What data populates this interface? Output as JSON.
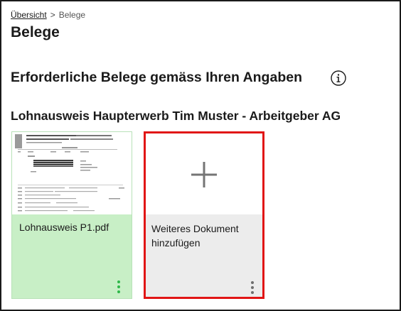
{
  "breadcrumb": {
    "parent": "Übersicht",
    "separator": ">",
    "current": "Belege"
  },
  "page_title": "Belege",
  "section": {
    "title": "Erforderliche Belege gemäss Ihren Angaben",
    "info_icon": "info-circle-icon"
  },
  "employment": {
    "title": "Lohnausweis Haupterwerb Tim Muster - Arbeitgeber AG",
    "documents": [
      {
        "filename": "Lohnausweis P1.pdf",
        "thumbnail_icon": "document-thumbnail",
        "menu_icon": "kebab-menu-icon",
        "accent": "#c8efc6",
        "menu_color": "#2fb84a"
      }
    ],
    "add_card": {
      "label_line1": "Weiteres Dokument",
      "label_line2": "hinzufügen",
      "icon": "plus-icon",
      "menu_icon": "kebab-menu-icon",
      "highlight": "#e11515"
    }
  }
}
